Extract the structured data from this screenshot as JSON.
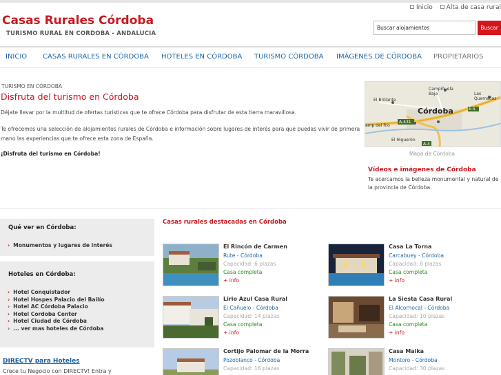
{
  "top_links": [
    "Inicio",
    "Alta de casa rural"
  ],
  "site": {
    "title": "Casas Rurales Córdoba",
    "slogan": "TURISMO RURAL EN CORDOBA - ANDALUCIA"
  },
  "search": {
    "value": "Buscar alojamientos",
    "button": "Buscar"
  },
  "nav": [
    "INICIO",
    "CASAS RURALES EN CÓRDOBA",
    "HOTELES EN CÓRDOBA",
    "TURISMO CÓRDOBA",
    "IMÁGENES DE CÓRDOBA",
    "PROPIETARIOS"
  ],
  "main": {
    "breadcrumb": "TURISMO EN CÓRDOBA",
    "heading": "Disfruta del turismo en Córdoba",
    "p1": "Déjate llevar por la multitud de ofertas turísticas que te ofrece Córdoba para disfrutar de esta tierra maravillosa.",
    "p2": "Te ofrecemos una selección de alojamientos rurales de Córdoba e información sobre lugares de interés para que puedas vivir de primera mano las experiencias que te ofrece esta zona de España.",
    "p3": "¡Disfruta del turismo en Córdoba!"
  },
  "map": {
    "caption": "Mapa de Córdoba",
    "labels": [
      "Campiñuela Baja",
      "Las Quemadas",
      "El Brillante",
      "Córdoba",
      "E-5",
      "A-431",
      "El Higuerón",
      "A-4",
      "amp del Río"
    ]
  },
  "videos": {
    "title": "Vídeos e imágenes de Córdoba",
    "text": "Te acercamos la belleza monumental y natural de la provincia de Córdoba."
  },
  "sidebar": {
    "que_ver": {
      "title": "Qué ver en Córdoba:",
      "items": [
        "Monumentos y lugares de interés"
      ]
    },
    "hoteles": {
      "title": "Hoteles en Córdoba:",
      "items": [
        "Hotel Conquistador",
        "Hotel Hospes Palacio del Bailío",
        "Hotel AC Córdoba Palacio",
        "Hotel Cordoba Center",
        "Hotel Ciudad de Córdoba",
        "... ver mas hoteles de Córdoba"
      ]
    },
    "ad": {
      "title": "DIRECTV para Hoteles",
      "text": "Crece tu Negocio con DIRECTV! Entra y"
    }
  },
  "featured": {
    "title": "Casas rurales destacadas en Córdoba",
    "cards": [
      {
        "name": "El Rincón de Carmen",
        "location": "Rute - Córdoba",
        "capacity": "Capacidad: 6 plazas",
        "status": "Casa completa",
        "more": "+ info",
        "scene": "pool"
      },
      {
        "name": "Casa La Torna",
        "location": "Carcabuey - Córdoba",
        "capacity": "Capacidad: 8 plazas",
        "status": "Casa completa",
        "more": "+ info",
        "scene": "night"
      },
      {
        "name": "Lirio Azul Casa Rural",
        "location": "El Cañuelo - Córdoba",
        "capacity": "Capacidad: 14 plazas",
        "status": "Casa completa",
        "more": "+ info",
        "scene": "village"
      },
      {
        "name": "La Siesta Casa Rural",
        "location": "El Alcornocal - Córdoba",
        "capacity": "Capacidad: 10 plazas",
        "status": "Casa completa",
        "more": "+ info",
        "scene": "interior"
      },
      {
        "name": "Cortijo Palomar de la Morra",
        "location": "Pozoblanco - Córdoba",
        "capacity": "Capacidad: 16 plazas",
        "status": "",
        "more": "",
        "scene": "field"
      },
      {
        "name": "Casa Maika",
        "location": "Montoro - Córdoba",
        "capacity": "Capacidad: 30 plazas",
        "status": "",
        "more": "",
        "scene": "courtyard"
      }
    ]
  },
  "colors": {
    "brand_red": "#c8181f",
    "link_blue": "#1b67a6",
    "available_green": "#2b8a1e"
  }
}
